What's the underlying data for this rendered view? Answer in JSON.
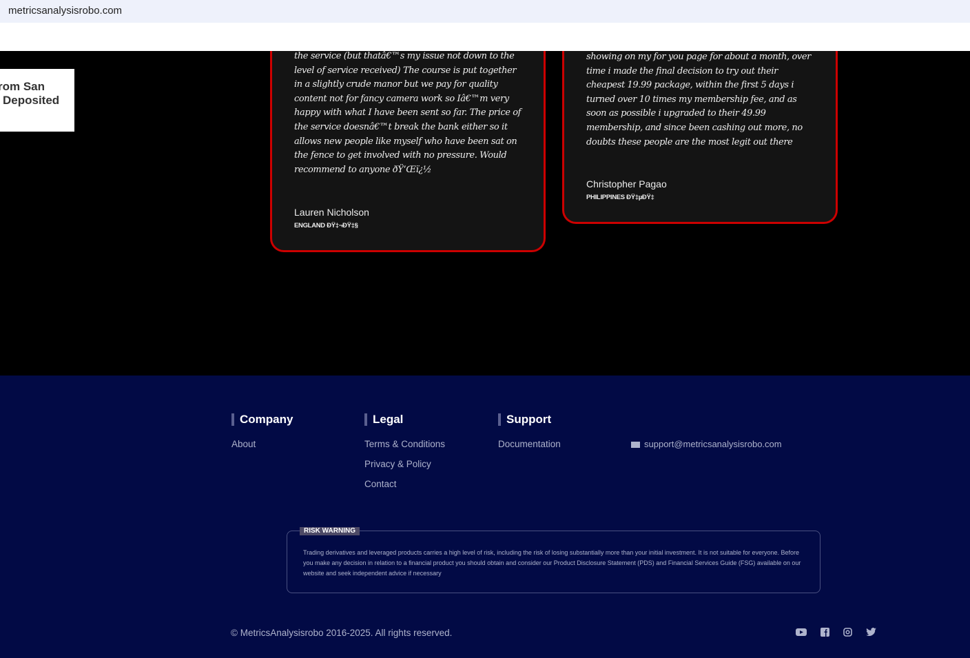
{
  "browser": {
    "url": "metricsanalysisrobo.com"
  },
  "popup": {
    "line1": "rom San",
    "line2": "Deposited"
  },
  "testimonials": [
    {
      "text": "the service (but thatâ€™s my issue not down to the level of service received) The course is put together in a slightly crude manor but we pay for quality content not for fancy camera work so Iâ€™m very happy with what I have been sent so far. The price of the service doesnâ€™t break the bank either so it allows new people like myself who have been sat on the fence to get involved with no pressure. Would recommend to anyone ðŸ‘Œï¿½",
      "name": "Lauren Nicholson",
      "country": "ENGLAND ÐŸ‡¬ÐŸ‡§"
    },
    {
      "text": "showing on my for you page for about a month, over time i made the final decision to try out their cheapest 19.99 package, within the first 5 days i turned over 10 times my membership fee, and as soon as possible i upgraded to their 49.99 membership, and since been cashing out more, no doubts these people are the most legit out there",
      "name": "Christopher Pagao",
      "country": "PHILIPPINES ÐŸ‡µÐŸ‡"
    }
  ],
  "footer": {
    "company": {
      "title": "Company",
      "links": [
        "About"
      ]
    },
    "legal": {
      "title": "Legal",
      "links": [
        "Terms & Conditions",
        "Privacy & Policy",
        "Contact"
      ]
    },
    "support": {
      "title": "Support",
      "links": [
        "Documentation"
      ]
    },
    "email": "support@metricsanalysisrobo.com",
    "risk_label": "RISK WARNING",
    "risk_text": "Trading derivatives and leveraged products carries a high level of risk, including the risk of losing substantially more than your initial investment. It is not suitable for everyone. Before you make any decision in relation to a financial product you should obtain and consider our Product Disclosure Statement (PDS) and Financial Services Guide (FSG) available on our website and seek independent advice if necessary",
    "copyright": "© MetricsAnalysisrobo 2016-2025. All rights reserved."
  }
}
